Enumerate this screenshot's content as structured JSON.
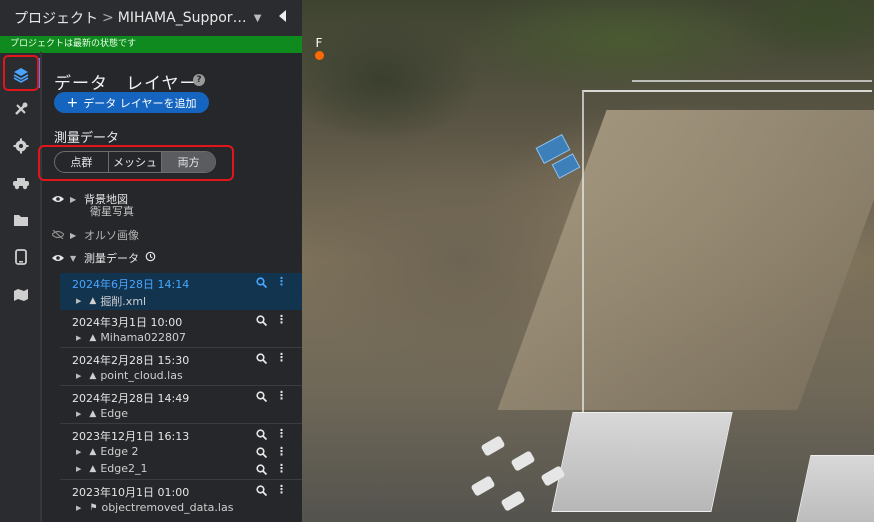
{
  "header": {
    "breadcrumb_root": "プロジェクト",
    "separator": ">",
    "project_name": "MIHAMA_SupportCe...",
    "status": "プロジェクトは最新の状態です"
  },
  "rail": {
    "items": [
      "layers-icon",
      "tools-icon",
      "settings-icon",
      "vehicle-icon",
      "folder-icon",
      "device-icon",
      "map-icon"
    ]
  },
  "panel": {
    "title": "データ　レイヤー",
    "help": "?",
    "add_button": "データ レイヤーを追加",
    "section_label": "測量データ",
    "segments": [
      "点群",
      "メッシュ",
      "両方"
    ],
    "selected_segment": "両方",
    "layers": {
      "base_map": "背景地図",
      "base_map_sub": "衛星写真",
      "ortho": "オルソ画像",
      "survey": "測量データ"
    },
    "surveys": [
      {
        "date": "2024年6月28日 14:14",
        "children": [
          "掘削.xml"
        ],
        "selected": true
      },
      {
        "date": "2024年3月1日 10:00",
        "children": [
          "Mihama022807"
        ],
        "selected": false
      },
      {
        "date": "2024年2月28日 15:30",
        "children": [
          "point_cloud.las"
        ],
        "selected": false
      },
      {
        "date": "2024年2月28日 14:49",
        "children": [
          "Edge"
        ],
        "selected": false
      },
      {
        "date": "2023年12月1日 16:13",
        "children": [
          "Edge 2",
          "Edge2_1"
        ],
        "selected": false
      },
      {
        "date": "2023年10月1日 01:00",
        "children": [
          "objectremoved_data.las"
        ],
        "selected": false
      }
    ]
  },
  "viewport": {
    "compass_label": "F"
  },
  "colors": {
    "accent": "#1565c0",
    "status_green": "#0f8a1f",
    "highlight_red": "#e0161b",
    "selected_row": "#13344f"
  }
}
